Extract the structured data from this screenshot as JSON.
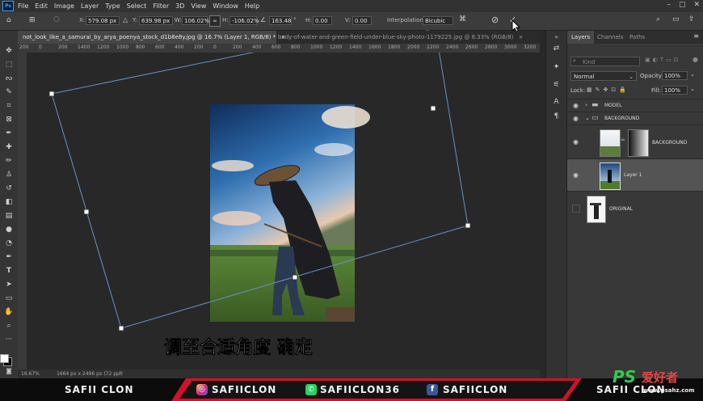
{
  "app": {
    "logo": "Ps"
  },
  "menu": [
    "File",
    "Edit",
    "Image",
    "Layer",
    "Type",
    "Select",
    "Filter",
    "3D",
    "View",
    "Window",
    "Help"
  ],
  "options": {
    "x_label": "X:",
    "x_value": "579.08 px",
    "y_label": "Y:",
    "y_value": "639.98 px",
    "w_label": "W:",
    "w_value": "106.02%",
    "h_label": "H:",
    "h_value": "-106.02%",
    "angle_value": "163.48",
    "angle_unit": "°",
    "hskew_label": "H:",
    "hskew_value": "0.00",
    "vskew_label": "V:",
    "vskew_value": "0.00",
    "interp_label": "Interpolation:",
    "interp_value": "Bicubic"
  },
  "tabs": [
    {
      "label": "not_look_like_a_samurai_by_arya_poenya_stock_d1b8e8y.jpg @ 16.7% (Layer 1, RGB/8) *",
      "active": true
    },
    {
      "label": "body-of-water-and-green-field-under-blue-sky-photo-1179225.jpg @ 8.33% (RGB/8)",
      "active": false
    }
  ],
  "ruler": [
    "200",
    "0",
    "200",
    "1400",
    "1200",
    "1000",
    "800",
    "600",
    "400",
    "200",
    "0",
    "200",
    "400",
    "600",
    "800",
    "1000",
    "1200",
    "1400",
    "1600",
    "1800",
    "2000",
    "2200",
    "2400",
    "2600",
    "2800",
    "3000",
    "3200"
  ],
  "caption": "调至合适角度 确定",
  "status": {
    "zoom": "16.67%",
    "doc_info": "1664 px x 2496 px (72 ppi)"
  },
  "layers_panel": {
    "tabs": [
      "Layers",
      "Channels",
      "Paths"
    ],
    "kind_placeholder": "Kind",
    "blend_mode": "Normal",
    "opacity_label": "Opacity:",
    "opacity_value": "100%",
    "lock_label": "Lock:",
    "fill_label": "Fill:",
    "fill_value": "100%",
    "layers": [
      {
        "name": "MODEL",
        "type": "group"
      },
      {
        "name": "BACKGROUND",
        "type": "group"
      },
      {
        "name": "BACKGROUND",
        "type": "masked"
      },
      {
        "name": "Layer 1",
        "type": "image"
      },
      {
        "name": "ORIGINAL",
        "type": "image"
      }
    ]
  },
  "banner": {
    "left_text": "SAFII CLON",
    "instagram": "SAFIICLON",
    "whatsapp": "SAFIICLON36",
    "facebook": "SAFIICLON",
    "right_text": "SAFII CLON"
  },
  "watermark": {
    "ps": "PS",
    "brand": "爱好者",
    "url": "www.psahz.com"
  },
  "colors": {
    "accent": "#31a8ff",
    "banner_red": "#d1122b"
  }
}
